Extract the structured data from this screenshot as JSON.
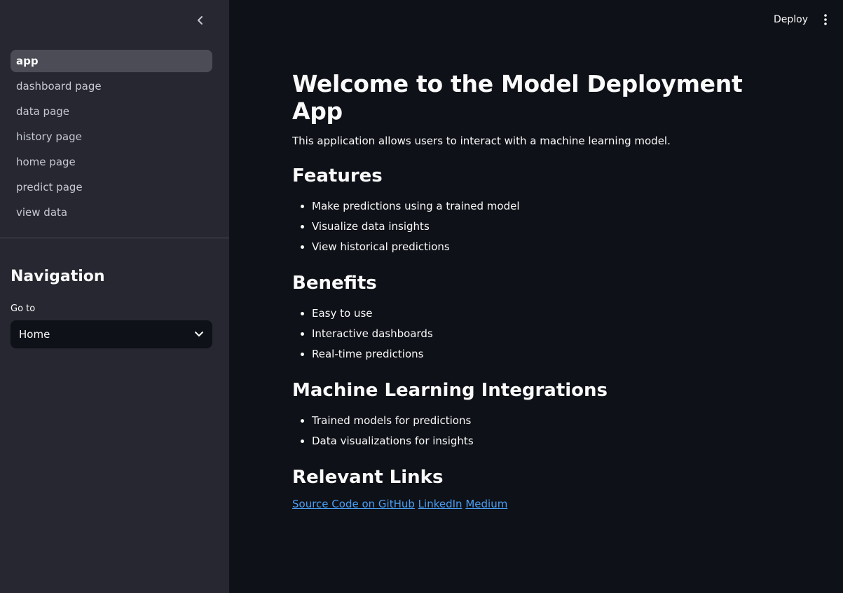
{
  "sidebar": {
    "nav_items": [
      {
        "label": "app",
        "active": true
      },
      {
        "label": "dashboard page",
        "active": false
      },
      {
        "label": "data page",
        "active": false
      },
      {
        "label": "history page",
        "active": false
      },
      {
        "label": "home page",
        "active": false
      },
      {
        "label": "predict page",
        "active": false
      },
      {
        "label": "view data",
        "active": false
      }
    ],
    "heading": "Navigation",
    "select": {
      "label": "Go to",
      "value": "Home"
    },
    "collapse_icon": "chevron-left-icon"
  },
  "topbar": {
    "deploy_label": "Deploy",
    "menu_icon": "kebab-menu-icon"
  },
  "main": {
    "title": "Welcome to the Model Deployment App",
    "intro": "This application allows users to interact with a machine learning model.",
    "sections": [
      {
        "heading": "Features",
        "items": [
          "Make predictions using a trained model",
          "Visualize data insights",
          "View historical predictions"
        ]
      },
      {
        "heading": "Benefits",
        "items": [
          "Easy to use",
          "Interactive dashboards",
          "Real-time predictions"
        ]
      },
      {
        "heading": "Machine Learning Integrations",
        "items": [
          "Trained models for predictions",
          "Data visualizations for insights"
        ]
      }
    ],
    "links_heading": "Relevant Links",
    "links": [
      "Source Code on GitHub",
      "LinkedIn",
      "Medium"
    ]
  },
  "colors": {
    "sidebar_bg": "#262730",
    "main_bg": "#0e1117",
    "active_item_bg": "#4b4c56",
    "link": "#4a9ff5",
    "text": "#fafafa"
  }
}
